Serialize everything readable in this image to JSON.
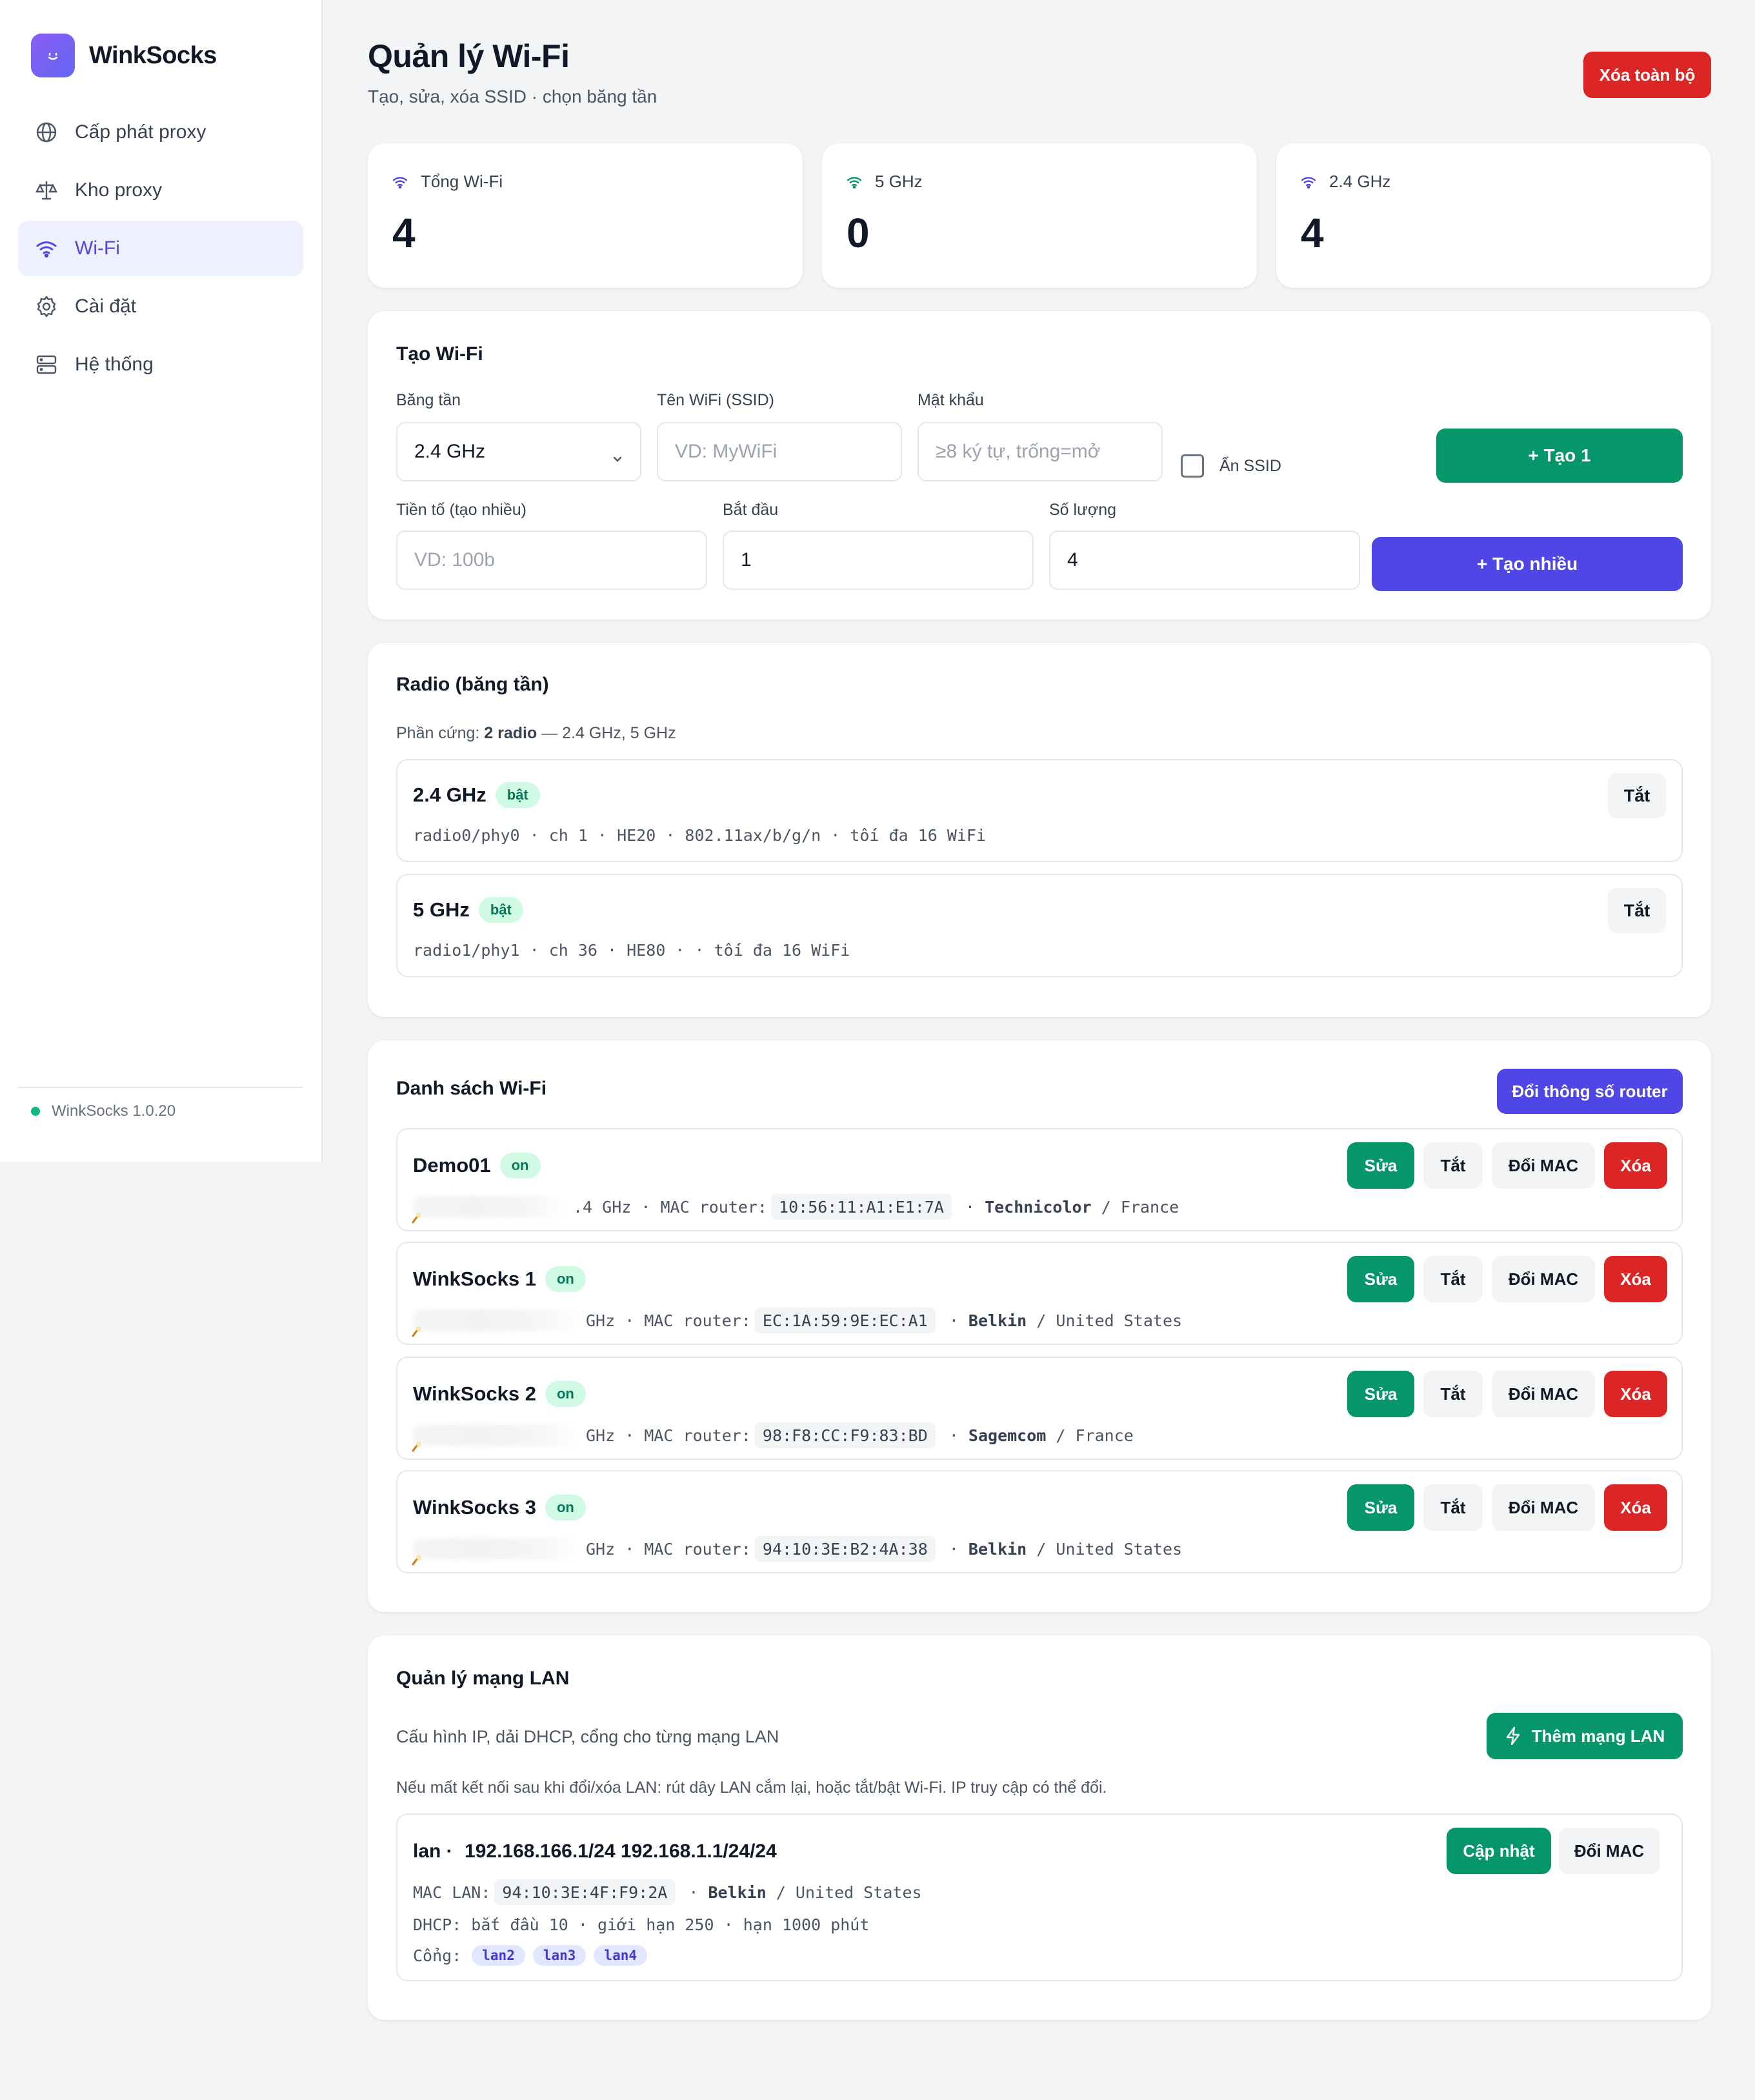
{
  "app": {
    "name": "WinkSocks",
    "version": "WinkSocks 1.0.20"
  },
  "nav": [
    {
      "label": "Cấp phát proxy",
      "icon": "globe-icon",
      "active": false
    },
    {
      "label": "Kho proxy",
      "icon": "scale-icon",
      "active": false
    },
    {
      "label": "Wi-Fi",
      "icon": "wifi-icon",
      "active": true
    },
    {
      "label": "Cài đặt",
      "icon": "gear-icon",
      "active": false
    },
    {
      "label": "Hệ thống",
      "icon": "server-icon",
      "active": false
    }
  ],
  "header": {
    "title": "Quản lý Wi-Fi",
    "subtitle": "Tạo, sửa, xóa SSID · chọn băng tần",
    "clear_all": "Xóa toàn bộ"
  },
  "stats": [
    {
      "label": "Tổng Wi-Fi",
      "value": "4",
      "icon_color": "#4f46e5"
    },
    {
      "label": "5 GHz",
      "value": "0",
      "icon_color": "#059669"
    },
    {
      "label": "2.4 GHz",
      "value": "4",
      "icon_color": "#4f46e5"
    }
  ],
  "create": {
    "title": "Tạo Wi-Fi",
    "band_label": "Băng tần",
    "band_value": "2.4 GHz",
    "ssid_label": "Tên WiFi (SSID)",
    "ssid_placeholder": "VD: MyWiFi",
    "password_label": "Mật khẩu",
    "password_placeholder": "≥8 ký tự, trống=mở",
    "hide_ssid_label": "Ẩn SSID",
    "create_one": "+ Tạo 1",
    "prefix_label": "Tiền tố (tạo nhiều)",
    "prefix_placeholder": "VD: 100b",
    "start_label": "Bắt đầu",
    "start_value": "1",
    "count_label": "Số lượng",
    "count_value": "4",
    "create_many": "+ Tạo nhiều"
  },
  "radio": {
    "title": "Radio (băng tần)",
    "hw_prefix": "Phần cứng: ",
    "hw_count": "2 radio",
    "hw_suffix": " — 2.4 GHz, 5 GHz",
    "items": [
      {
        "name": "2.4 GHz",
        "badge": "bật",
        "meta": "radio0/phy0 · ch 1 · HE20 · 802.11ax/b/g/n · tối đa 16 WiFi",
        "button": "Tắt"
      },
      {
        "name": "5 GHz",
        "badge": "bật",
        "meta": "radio1/phy1 · ch 36 · HE80 · · tối đa 16 WiFi",
        "button": "Tắt"
      }
    ]
  },
  "wifi_list": {
    "title": "Danh sách Wi-Fi",
    "change_router": "Đổi thông số router",
    "edit": "Sửa",
    "disable": "Tắt",
    "change_mac": "Đổi MAC",
    "delete": "Xóa",
    "mac_label": "MAC router:",
    "items": [
      {
        "name": "Demo01",
        "badge": "on",
        "band": ".4 GHz",
        "mac": "10:56:11:A1:E1:7A",
        "vendor": "Technicolor",
        "country": "France"
      },
      {
        "name": "WinkSocks 1",
        "badge": "on",
        "band": "GHz",
        "mac": "EC:1A:59:9E:EC:A1",
        "vendor": "Belkin",
        "country": "United States"
      },
      {
        "name": "WinkSocks 2",
        "badge": "on",
        "band": "GHz",
        "mac": "98:F8:CC:F9:83:BD",
        "vendor": "Sagemcom",
        "country": "France"
      },
      {
        "name": "WinkSocks 3",
        "badge": "on",
        "band": "GHz",
        "mac": "94:10:3E:B2:4A:38",
        "vendor": "Belkin",
        "country": "United States"
      }
    ]
  },
  "lan": {
    "title": "Quản lý mạng LAN",
    "description": "Cấu hình IP, dải DHCP, cổng cho từng mạng LAN",
    "add": "Thêm mạng LAN",
    "warning": "Nếu mất kết nối sau khi đổi/xóa LAN: rút dây LAN cắm lại, hoặc tắt/bật Wi-Fi. IP truy cập có thể đổi.",
    "item": {
      "name": "lan ·",
      "ip": "192.168.166.1/24 192.168.1.1/24/24",
      "update": "Cập nhật",
      "change_mac": "Đổi MAC",
      "mac_label": "MAC LAN:",
      "mac": "94:10:3E:4F:F9:2A",
      "vendor": "Belkin",
      "country": "United States",
      "dhcp": "DHCP: bắt đầu 10 · giới hạn 250 · hạn 1000 phút",
      "ports_label": "Cổng:",
      "ports": [
        "lan2",
        "lan3",
        "lan4"
      ]
    }
  }
}
